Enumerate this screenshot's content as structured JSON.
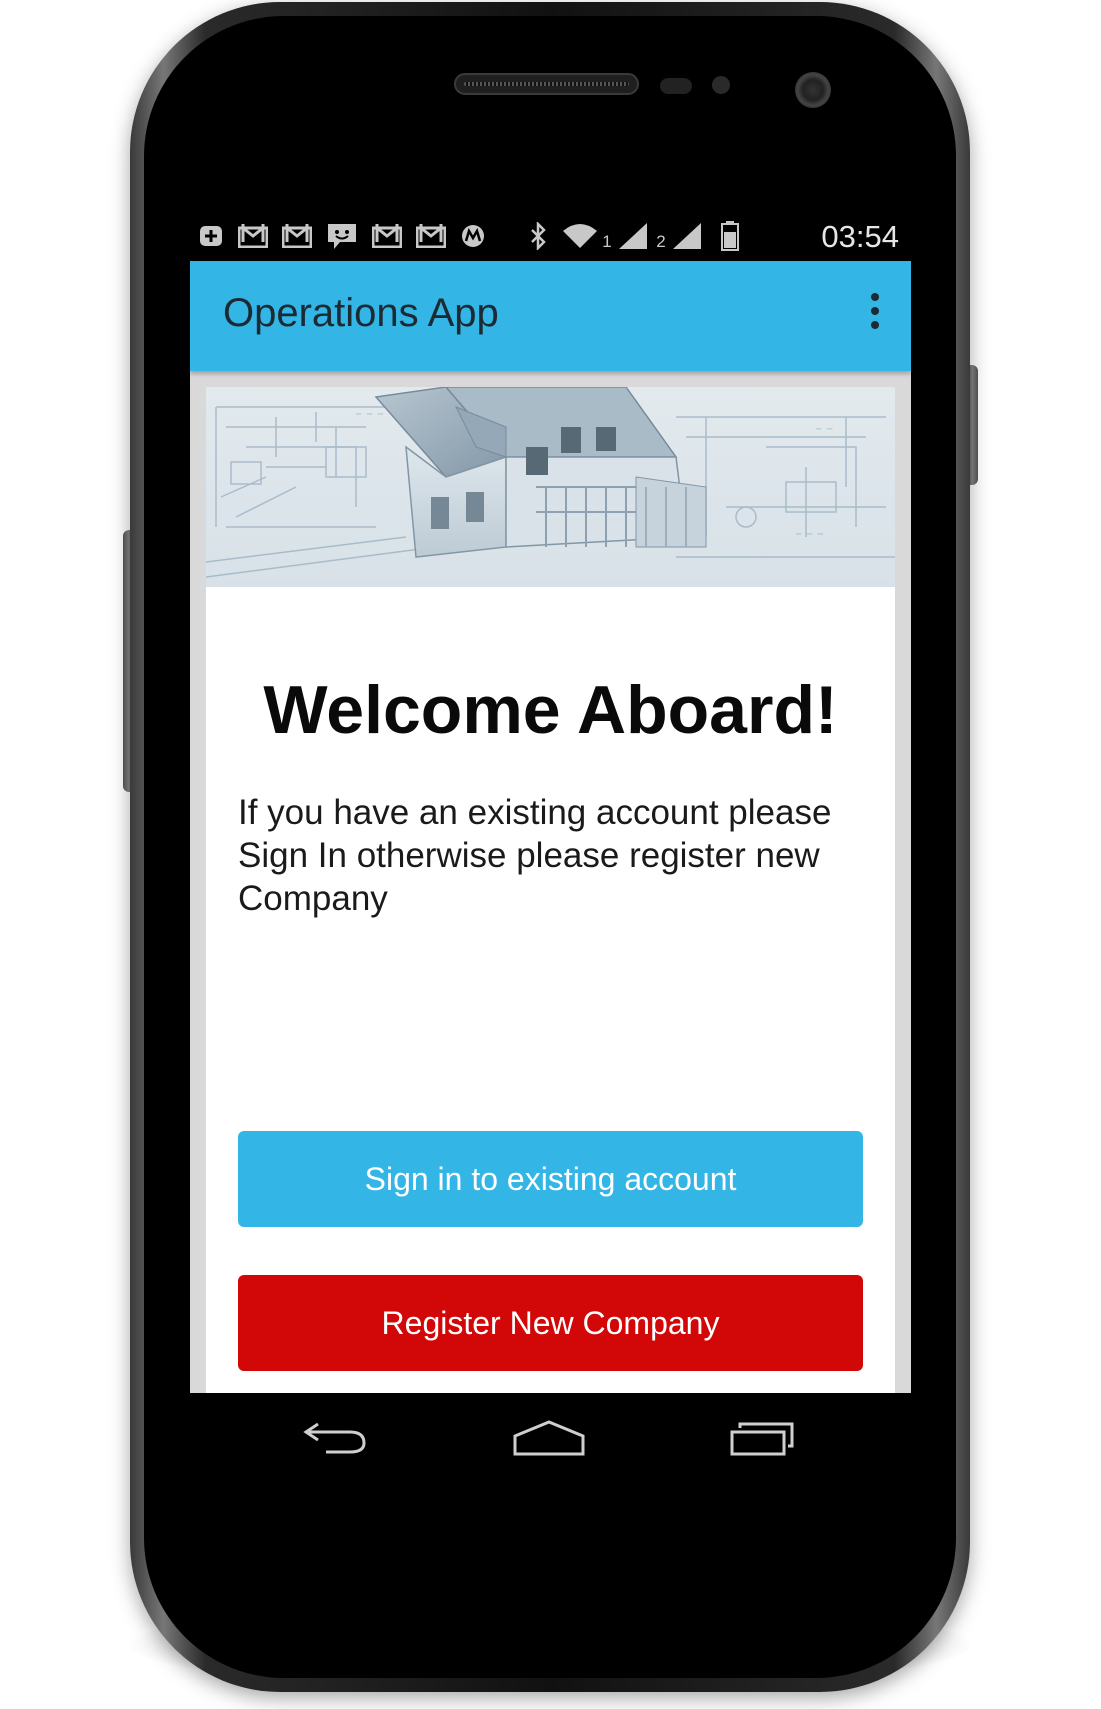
{
  "status_bar": {
    "time": "03:54",
    "sim1_label": "1",
    "sim2_label": "2",
    "icons": [
      "add-icon",
      "gmail-icon",
      "gmail-icon",
      "sms-icon",
      "gmail-icon",
      "gmail-icon",
      "motorola-icon",
      "bluetooth-icon",
      "wifi-icon",
      "signal-icon",
      "signal-icon",
      "battery-icon"
    ]
  },
  "action_bar": {
    "title": "Operations App",
    "overflow_icon": "more-vert-icon",
    "color": "#33b5e5"
  },
  "hero": {
    "image": "house-blueprint-image"
  },
  "main": {
    "heading": "Welcome Aboard!",
    "description": "If you have an existing account please Sign In otherwise please register new Company",
    "signin_label": "Sign in to existing account",
    "register_label": "Register New Company",
    "signin_color": "#33b5e5",
    "register_color": "#d20707"
  },
  "nav_bar": {
    "icons": [
      "back-icon",
      "home-icon",
      "recent-apps-icon"
    ]
  }
}
